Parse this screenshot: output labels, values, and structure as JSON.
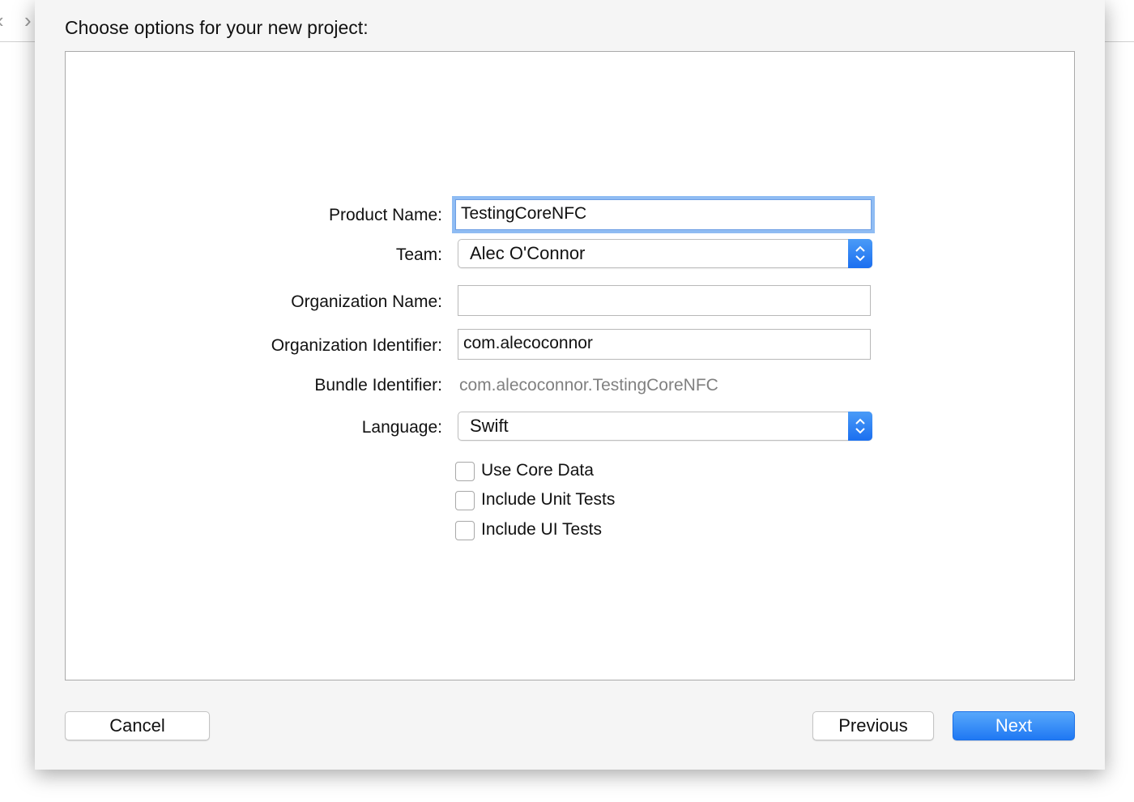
{
  "sheet": {
    "title": "Choose options for your new project:"
  },
  "background": {
    "back_glyph": "‹",
    "forward_glyph": "›"
  },
  "form": {
    "product_name": {
      "label": "Product Name:",
      "value": "TestingCoreNFC"
    },
    "team": {
      "label": "Team:",
      "value": "Alec O'Connor"
    },
    "organization_name": {
      "label": "Organization Name:",
      "value": ""
    },
    "organization_identifier": {
      "label": "Organization Identifier:",
      "value": "com.alecoconnor"
    },
    "bundle_identifier": {
      "label": "Bundle Identifier:",
      "value": "com.alecoconnor.TestingCoreNFC"
    },
    "language": {
      "label": "Language:",
      "value": "Swift"
    },
    "checkboxes": [
      {
        "label": "Use Core Data",
        "checked": false
      },
      {
        "label": "Include Unit Tests",
        "checked": false
      },
      {
        "label": "Include UI Tests",
        "checked": false
      }
    ]
  },
  "buttons": {
    "cancel": "Cancel",
    "previous": "Previous",
    "next": "Next"
  },
  "colors": {
    "accent": "#1f78f3",
    "focus_ring": "#8fbcf3",
    "sheet_bg": "#f5f5f5"
  },
  "icons": [
    "chevron-left-icon",
    "chevron-right-icon",
    "popup-stepper-icon"
  ]
}
